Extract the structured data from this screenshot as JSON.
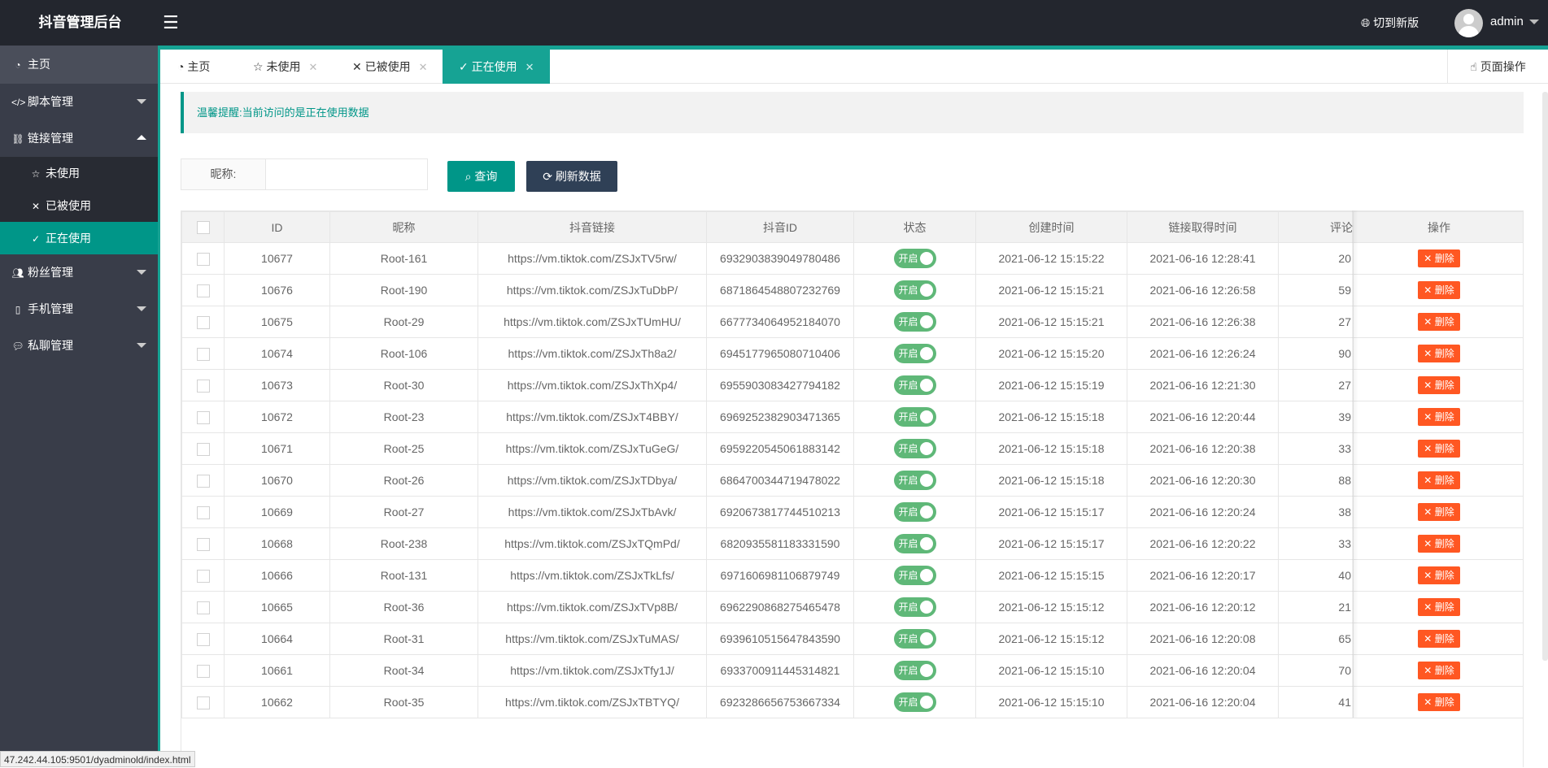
{
  "header": {
    "title": "抖音管理后台",
    "menu_icon": "hamburger-icon",
    "new_version": "切到新版",
    "user": "admin"
  },
  "sidebar": {
    "home": "主页",
    "script_mgmt": "脚本管理",
    "link_mgmt": "链接管理",
    "sub": [
      "未使用",
      "已被使用",
      "正在使用"
    ],
    "fans_mgmt": "粉丝管理",
    "phone_mgmt": "手机管理",
    "dm_mgmt": "私聊管理"
  },
  "tabs": [
    {
      "label": "主页"
    },
    {
      "label": "未使用"
    },
    {
      "label": "已被使用"
    },
    {
      "label": "正在使用"
    }
  ],
  "page_ops": "页面操作",
  "alert": "温馨提醒:当前访问的是正在使用数据",
  "search": {
    "label": "昵称:",
    "value": "",
    "query_btn": "查询",
    "refresh_btn": "刷新数据"
  },
  "table": {
    "columns": [
      "ID",
      "昵称",
      "抖音链接",
      "抖音ID",
      "状态",
      "创建时间",
      "链接取得时间",
      "评论",
      "操作"
    ],
    "switch_label": "开启",
    "delete_label": "删除",
    "rows": [
      [
        "10677",
        "Root-161",
        "https://vm.tiktok.com/ZSJxTV5rw/",
        "6932903839049780486",
        "2021-06-12 15:15:22",
        "2021-06-16 12:28:41",
        "20"
      ],
      [
        "10676",
        "Root-190",
        "https://vm.tiktok.com/ZSJxTuDbP/",
        "6871864548807232769",
        "2021-06-12 15:15:21",
        "2021-06-16 12:26:58",
        "59"
      ],
      [
        "10675",
        "Root-29",
        "https://vm.tiktok.com/ZSJxTUmHU/",
        "6677734064952184070",
        "2021-06-12 15:15:21",
        "2021-06-16 12:26:38",
        "27"
      ],
      [
        "10674",
        "Root-106",
        "https://vm.tiktok.com/ZSJxTh8a2/",
        "6945177965080710406",
        "2021-06-12 15:15:20",
        "2021-06-16 12:26:24",
        "90"
      ],
      [
        "10673",
        "Root-30",
        "https://vm.tiktok.com/ZSJxThXp4/",
        "6955903083427794182",
        "2021-06-12 15:15:19",
        "2021-06-16 12:21:30",
        "27"
      ],
      [
        "10672",
        "Root-23",
        "https://vm.tiktok.com/ZSJxT4BBY/",
        "6969252382903471365",
        "2021-06-12 15:15:18",
        "2021-06-16 12:20:44",
        "39"
      ],
      [
        "10671",
        "Root-25",
        "https://vm.tiktok.com/ZSJxTuGeG/",
        "6959220545061883142",
        "2021-06-12 15:15:18",
        "2021-06-16 12:20:38",
        "33"
      ],
      [
        "10670",
        "Root-26",
        "https://vm.tiktok.com/ZSJxTDbya/",
        "6864700344719478022",
        "2021-06-12 15:15:18",
        "2021-06-16 12:20:30",
        "88"
      ],
      [
        "10669",
        "Root-27",
        "https://vm.tiktok.com/ZSJxTbAvk/",
        "6920673817744510213",
        "2021-06-12 15:15:17",
        "2021-06-16 12:20:24",
        "38"
      ],
      [
        "10668",
        "Root-238",
        "https://vm.tiktok.com/ZSJxTQmPd/",
        "6820935581183331590",
        "2021-06-12 15:15:17",
        "2021-06-16 12:20:22",
        "33"
      ],
      [
        "10666",
        "Root-131",
        "https://vm.tiktok.com/ZSJxTkLfs/",
        "6971606981106879749",
        "2021-06-12 15:15:15",
        "2021-06-16 12:20:17",
        "40"
      ],
      [
        "10665",
        "Root-36",
        "https://vm.tiktok.com/ZSJxTVp8B/",
        "6962290868275465478",
        "2021-06-12 15:15:12",
        "2021-06-16 12:20:12",
        "21"
      ],
      [
        "10664",
        "Root-31",
        "https://vm.tiktok.com/ZSJxTuMAS/",
        "6939610515647843590",
        "2021-06-12 15:15:12",
        "2021-06-16 12:20:08",
        "65"
      ],
      [
        "10661",
        "Root-34",
        "https://vm.tiktok.com/ZSJxTfy1J/",
        "6933700911445314821",
        "2021-06-12 15:15:10",
        "2021-06-16 12:20:04",
        "70"
      ],
      [
        "10662",
        "Root-35",
        "https://vm.tiktok.com/ZSJxTBTYQ/",
        "6923286656753667334",
        "2021-06-12 15:15:10",
        "2021-06-16 12:20:04",
        "41"
      ]
    ]
  },
  "status_url": "47.242.44.105:9501/dyadminold/index.html",
  "colors": {
    "primary": "#009688",
    "header": "#23262e",
    "sidebar": "#393d49",
    "danger": "#ff5722",
    "switch_on": "#5fb878"
  }
}
